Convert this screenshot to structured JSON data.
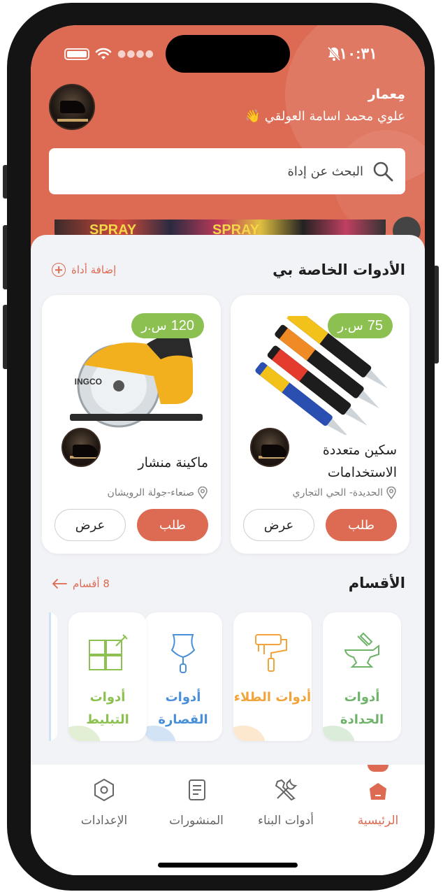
{
  "status_bar": {
    "time": "١٠:٣١"
  },
  "header": {
    "role": "مِعمار",
    "user_name": "علوي محمد اسامة العولقي 👋",
    "search_placeholder": "البحث عن إداة",
    "banner_words": [
      "SPRAY",
      "SPRAY"
    ]
  },
  "my_tools": {
    "title": "الأدوات الخاصة بي",
    "add_link": "إضافة أداة",
    "cards": [
      {
        "price_value": "75",
        "currency": "س.ر",
        "name": "سكين متعددة الاستخدامات",
        "location": "الحديدة- الحي التجاري",
        "order_label": "طلب",
        "view_label": "عرض"
      },
      {
        "price_value": "120",
        "currency": "س.ر",
        "name": "ماكينة منشار",
        "location": "صنعاء-جولة الرويشان",
        "order_label": "طلب",
        "view_label": "عرض"
      }
    ]
  },
  "categories": {
    "title": "الأقسام",
    "count_link": "8 أقسام",
    "items": [
      {
        "label": "أدوات الحدادة",
        "icon": "anvil-hammer-icon",
        "color": "#6fb36a"
      },
      {
        "label": "أدوات الطلاء",
        "icon": "paint-roller-icon",
        "color": "#f2a33a"
      },
      {
        "label": "أدوات القصارة",
        "icon": "trowel-icon",
        "color": "#4a90d9"
      },
      {
        "label": "أدوات التبليط",
        "icon": "tiles-icon",
        "color": "#8cc152"
      }
    ]
  },
  "bottom_nav": {
    "items": [
      {
        "label": "الرئيسية",
        "icon": "home-icon",
        "active": true
      },
      {
        "label": "أدوات البناء",
        "icon": "tools-icon",
        "active": false
      },
      {
        "label": "المنشورات",
        "icon": "document-icon",
        "active": false
      },
      {
        "label": "الإعدادات",
        "icon": "settings-icon",
        "active": false
      }
    ]
  },
  "colors": {
    "primary": "#dd6a52",
    "price_badge": "#8cc152",
    "background": "#f2f3f7"
  }
}
